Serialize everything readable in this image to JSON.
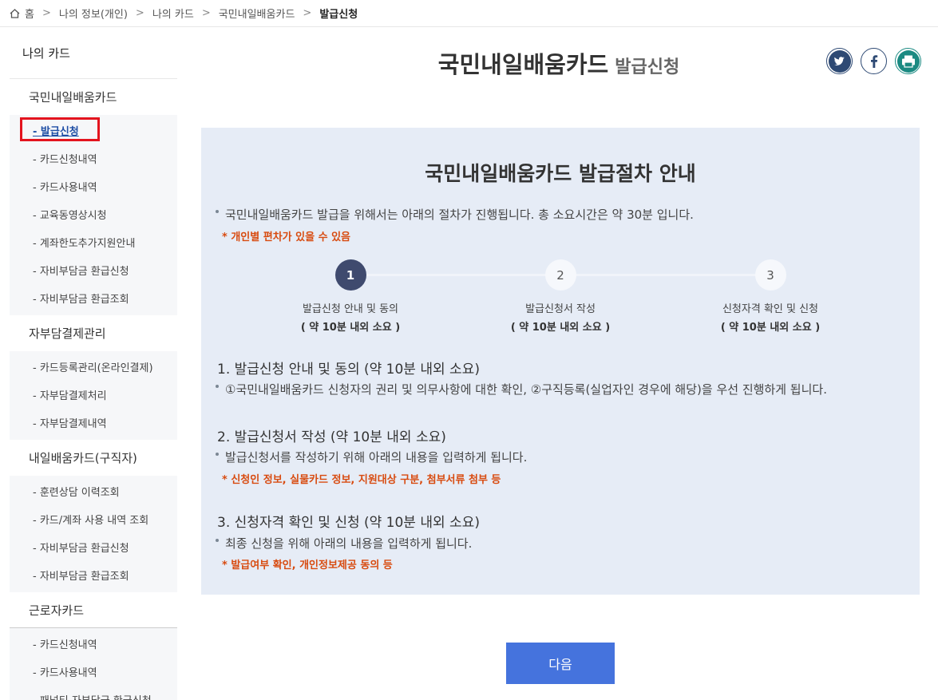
{
  "breadcrumb": [
    {
      "label": "홈"
    },
    {
      "label": "나의 정보(개인)"
    },
    {
      "label": "나의 카드"
    },
    {
      "label": "국민내일배움카드"
    },
    {
      "label": "발급신청"
    }
  ],
  "sidebar": {
    "title": "나의 카드",
    "sections": [
      {
        "label": "국민내일배움카드",
        "items": [
          "- 발급신청",
          "- 카드신청내역",
          "- 카드사용내역",
          "- 교육동영상시청",
          "- 계좌한도추가지원안내",
          "- 자비부담금 환급신청",
          "- 자비부담금 환급조회"
        ]
      },
      {
        "label": "자부담결제관리",
        "items": [
          "- 카드등록관리(온라인결제)",
          "- 자부담결제처리",
          "- 자부담결제내역"
        ]
      },
      {
        "label": "내일배움카드(구직자)",
        "items": [
          "- 훈련상담 이력조회",
          "- 카드/계좌 사용 내역 조회",
          "- 자비부담금 환급신청",
          "- 자비부담금 환급조회"
        ]
      },
      {
        "label": "근로자카드",
        "items": [
          "- 카드신청내역",
          "- 카드사용내역",
          "- 패널티 자부담금 환급신청"
        ]
      }
    ]
  },
  "header": {
    "title": "국민내일배움카드",
    "subtitle": "발급신청"
  },
  "guide": {
    "title": "국민내일배움카드 발급절차 안내",
    "intro": "국민내일배움카드 발급을 위해서는 아래의 절차가 진행됩니다. 총 소요시간은 약 30분 입니다.",
    "intro_note": "* 개인별 편차가 있을 수 있음",
    "steps": [
      {
        "num": "1",
        "label": "발급신청 안내 및 동의",
        "time": "( 약 10분 내외 소요 )"
      },
      {
        "num": "2",
        "label": "발급신청서 작성",
        "time": "( 약 10분 내외 소요 )"
      },
      {
        "num": "3",
        "label": "신청자격 확인 및 신청",
        "time": "( 약 10분 내외 소요 )"
      }
    ],
    "sections": [
      {
        "title": "1. 발급신청 안내 및 동의 (약 10분 내외 소요)",
        "desc": "①국민내일배움카드 신청자의 권리 및 의무사항에 대한 확인, ②구직등록(실업자인 경우에 해당)을 우선 진행하게 됩니다.",
        "note": ""
      },
      {
        "title": "2. 발급신청서 작성 (약 10분 내외 소요)",
        "desc": "발급신청서를 작성하기 위해 아래의 내용을 입력하게 됩니다.",
        "note": "* 신청인 정보, 실물카드 정보, 지원대상 구분, 첨부서류 첨부 등"
      },
      {
        "title": "3. 신청자격 확인 및 신청 (약 10분 내외 소요)",
        "desc": "최종 신청을 위해 아래의 내용을 입력하게 됩니다.",
        "note": "* 발급여부 확인, 개인정보제공 동의 등"
      }
    ]
  },
  "next_button": "다음",
  "colors": {
    "accent": "#4573dd",
    "guide_bg": "#e6ecf6",
    "note": "#d84b10",
    "active_step": "#3f4a6e",
    "highlight_box": "#e3141e"
  }
}
